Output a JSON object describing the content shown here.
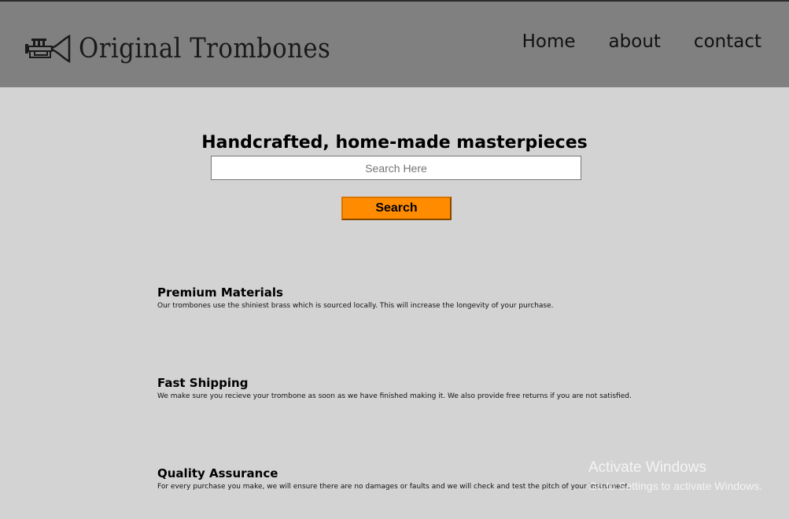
{
  "header": {
    "brand": "Original Trombones",
    "nav": [
      {
        "label": "Home"
      },
      {
        "label": "about"
      },
      {
        "label": "contact"
      }
    ]
  },
  "hero": {
    "title": "Handcrafted, home-made masterpieces",
    "search_placeholder": "Search Here",
    "search_button": "Search"
  },
  "features": [
    {
      "title": "Premium Materials",
      "text": "Our trombones use the shiniest brass which is sourced locally. This will increase the longevity of your purchase."
    },
    {
      "title": "Fast Shipping",
      "text": "We make sure you recieve your trombone as soon as we have finished making it. We also provide free returns if you are not satisfied."
    },
    {
      "title": "Quality Assurance",
      "text": "For every purchase you make, we will ensure there are no damages or faults and we will check and test the pitch of your instrument."
    }
  ],
  "watermark": {
    "title": "Activate Windows",
    "subtitle": "Go to Settings to activate Windows."
  },
  "colors": {
    "header_bg": "#808080",
    "page_bg": "#d3d3d3",
    "button_bg": "#ff8c00"
  }
}
